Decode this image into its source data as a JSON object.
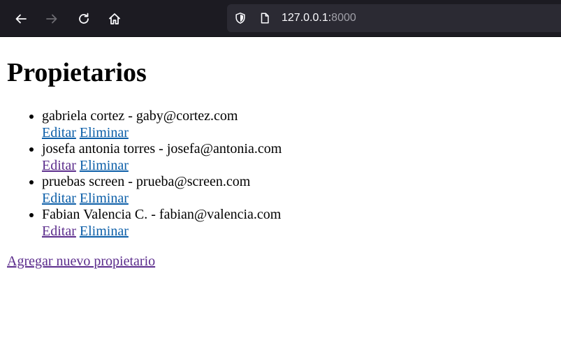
{
  "browser": {
    "url_host": "127.0.0.1:",
    "url_port": "8000",
    "icons": [
      "back-arrow-icon",
      "forward-arrow-icon",
      "reload-icon",
      "home-icon",
      "shield-icon",
      "page-icon"
    ]
  },
  "page": {
    "title": "Propietarios",
    "owners": [
      {
        "text": "gabriela cortez - gaby@cortez.com",
        "edit": "Editar",
        "delete": "Eliminar"
      },
      {
        "text": "josefa antonia torres - josefa@antonia.com",
        "edit": "Editar",
        "delete": "Eliminar"
      },
      {
        "text": "pruebas screen - prueba@screen.com",
        "edit": "Editar",
        "delete": "Eliminar"
      },
      {
        "text": "Fabian Valencia C. - fabian@valencia.com",
        "edit": "Editar",
        "delete": "Eliminar"
      }
    ],
    "add_link": "Agregar nuevo propietario"
  },
  "colors": {
    "toolbar_bg": "#1c1b22",
    "urlbar_bg": "#2b2a33",
    "link": "#0b5ea8",
    "visited_link": "#5b2c8c"
  }
}
